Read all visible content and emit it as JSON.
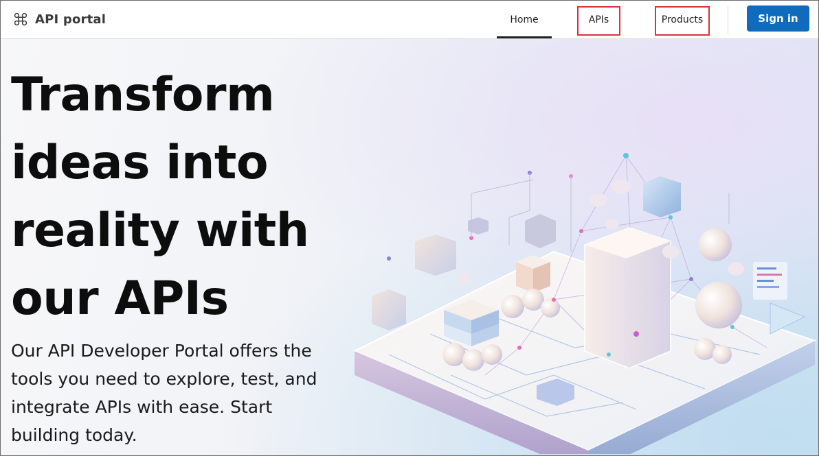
{
  "header": {
    "brand_name": "API portal",
    "brand_icon": "command-icon",
    "nav": {
      "home": "Home",
      "apis": "APIs",
      "products": "Products"
    },
    "sign_in": "Sign in"
  },
  "hero": {
    "title": "Transform ideas into reality with our APIs",
    "description": "Our API Developer Portal offers the tools you need to explore, test, and integrate APIs with ease. Start building today."
  },
  "colors": {
    "accent": "#0f6cbd",
    "highlight": "#d8323a"
  }
}
